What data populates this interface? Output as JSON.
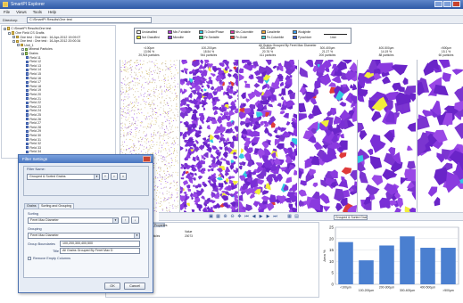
{
  "window": {
    "title": "SmartPI Explorer"
  },
  "menu": [
    "File",
    "Views",
    "Tools",
    "Help"
  ],
  "directory": {
    "label": "Directory:",
    "value": "C:\\SmartPI Results\\One test"
  },
  "tree": {
    "root": "C:\\SmartPI Results\\One test",
    "items": [
      {
        "label": "One Field CS Grafts",
        "level": 1,
        "icon": "folder-icon"
      },
      {
        "label": "One test : One test : 16-Apr-2012 19:09:07",
        "level": 2,
        "icon": "folder-icon"
      },
      {
        "label": "One test : One test : 16-Apr-2012 20:00:34",
        "level": 2,
        "icon": "folder-icon"
      },
      {
        "label": "Unit_1",
        "level": 3,
        "icon": "folder-icon"
      },
      {
        "label": "Mineral Particles",
        "level": 4,
        "icon": "graph-icon"
      },
      {
        "label": "Grains",
        "level": 4,
        "icon": "graph-icon"
      }
    ],
    "fields": [
      "Field 11",
      "Field 12",
      "Field 13",
      "Field 14",
      "Field 15",
      "Field 16",
      "Field 17",
      "Field 18",
      "Field 19",
      "Field 20",
      "Field 21",
      "Field 22",
      "Field 23",
      "Field 24",
      "Field 25",
      "Field 26",
      "Field 27",
      "Field 28",
      "Field 29",
      "Field 30",
      "Field 31",
      "Field 32",
      "Field 33",
      "Field 34",
      "Field 35",
      "Field 36",
      "Field 37",
      "Field 38"
    ]
  },
  "legend": {
    "items": [
      {
        "label": "Unclassified",
        "color": "#f5f5f5"
      },
      {
        "label": "Min-F.sintable",
        "color": "#b43bd8"
      },
      {
        "label": "Ti-Oxide/Phase",
        "color": "#33c9e3"
      },
      {
        "label": "Mn-Columbite",
        "color": "#d83ba0"
      },
      {
        "label": "Cassiterite",
        "color": "#f0a73a"
      },
      {
        "label": "Wodginite",
        "color": "#3aa0f0"
      },
      {
        "label": "Not Classified",
        "color": "#f2ee3a"
      },
      {
        "label": "Microlite",
        "color": "#8a3adf"
      },
      {
        "label": "Fe-Tantalite",
        "color": "#2ad07a"
      },
      {
        "label": "Fe-Oxide",
        "color": "#df3a3a"
      },
      {
        "label": "Fe-Columbite",
        "color": "#3ad0d0"
      },
      {
        "label": "Pyrochlore",
        "color": "#3a5ad8"
      }
    ],
    "scale_label": "1mm"
  },
  "group_title": "All Grains Grouped By Feret Max Diameter",
  "columns": [
    {
      "range": "<100µm",
      "pct": "13.96 %",
      "count": "20,924 particles"
    },
    {
      "range": "100-200µm",
      "pct": "18.54 %",
      "count": "944 particles"
    },
    {
      "range": "200-300µm",
      "pct": "20.76 %",
      "count": "411 particles"
    },
    {
      "range": "300-400µm",
      "pct": "21.27 %",
      "count": "200 particles"
    },
    {
      "range": "400-500µm",
      "pct": "14.19 %",
      "count": "88 particles"
    },
    {
      "range": ">500µm",
      "pct": "15.1 %",
      "count": "60 particles"
    }
  ],
  "filter_dialog": {
    "title": "Filter Settings",
    "filter_name_label": "Filter Name:",
    "filter_name_value": "Grouped & Sorted Grains",
    "tabs": [
      "Grains",
      "Sorting and Grouping"
    ],
    "sorting_label": "Sorting",
    "sorting_value": "Feret Max Diameter",
    "grouping_label": "Grouping",
    "grouping_value": "Feret Max Diameter",
    "group_boundaries_label": "Group Boundaries",
    "group_boundaries_value": "100,200,300,400,500",
    "title_field_label": "Title",
    "title_field_value": "All Grains Grouped By Feret Max D",
    "remove_empty_label": "Remove Empty Columns",
    "ok": "OK",
    "cancel": "Cancel"
  },
  "toolbar": {
    "filter_select": "Grouped & Sorted Grains",
    "icons": [
      "copy-icon",
      "save-icon",
      "zoom-in-icon",
      "zoom-out-icon",
      "pan-icon",
      "first-icon",
      "prev-icon",
      "play-icon",
      "next-icon",
      "last-icon",
      "grid-icon",
      "chart-icon"
    ]
  },
  "properties": {
    "tab": "Properties",
    "value_header": "Value",
    "rows": [
      {
        "name": "Particles",
        "value": "20073"
      }
    ]
  },
  "chart_data": {
    "type": "bar",
    "categories": [
      "<100µm",
      "100-200µm",
      "200-300µm",
      "300-400µm",
      "400-500µm",
      ">500µm"
    ],
    "tick_labels": [
      "<100µm",
      "100-200µm",
      "200-300µm",
      "300-400µm",
      "400-500µm",
      ">500µm"
    ],
    "values": [
      18.5,
      10.5,
      17.0,
      21.0,
      16.0,
      16.0
    ],
    "ylabel": "Area %",
    "ylim": [
      0,
      25
    ],
    "yticks": [
      0,
      5,
      10,
      15,
      20,
      25
    ],
    "bar_color": "#4a7fd0",
    "grid": true
  }
}
